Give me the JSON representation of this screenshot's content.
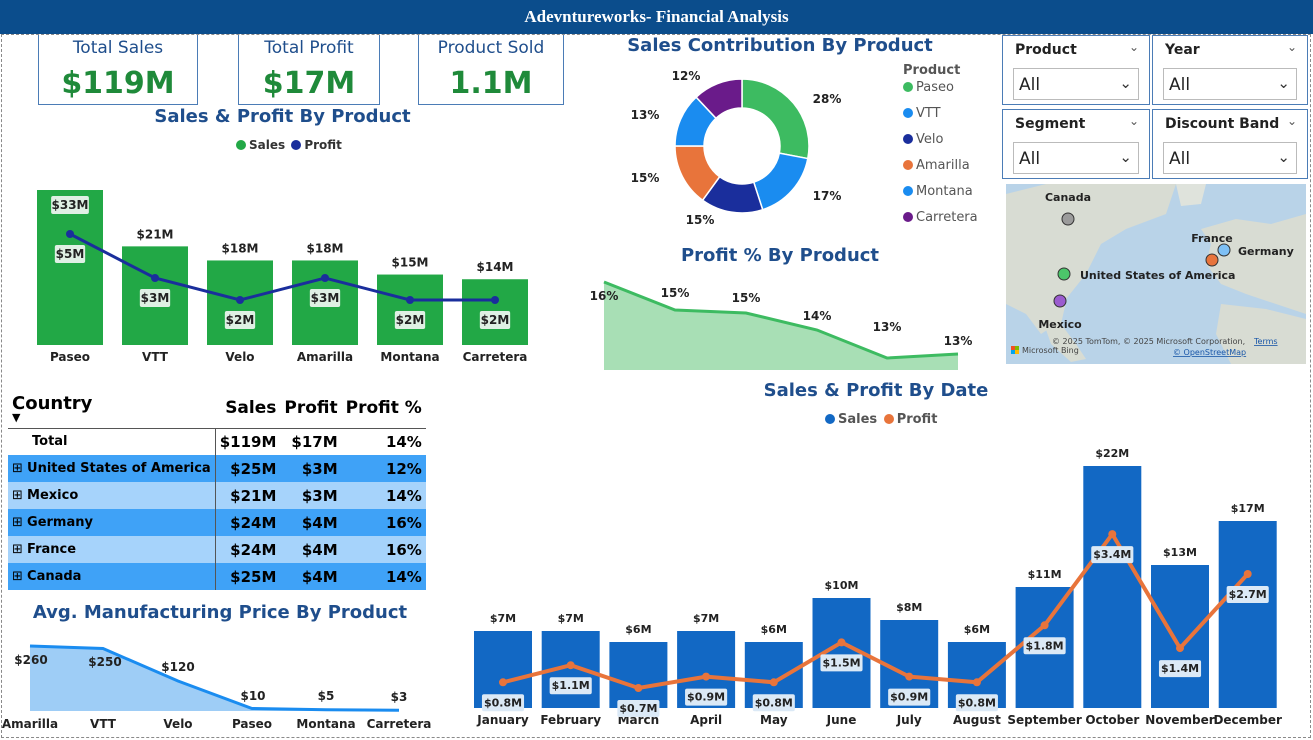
{
  "header": {
    "title": "Adevntureworks- Financial Analysis"
  },
  "kpis": [
    {
      "label": "Total Sales",
      "value": "$119M"
    },
    {
      "label": "Total Profit",
      "value": "$17M"
    },
    {
      "label": "Product Sold",
      "value": "1.1M"
    }
  ],
  "colors": {
    "sales_green": "#22a846",
    "profit_navy": "#1a2e9c",
    "sales_blue": "#1268c4",
    "profit_orange": "#e8743b",
    "area_green": "#a8dfb5",
    "area_blue": "#9ecdf6",
    "title_blue": "#1f4e8c"
  },
  "sales_profit_product": {
    "title": "Sales & Profit By Product",
    "legend": [
      "Sales",
      "Profit"
    ],
    "chart_data": {
      "type": "bar",
      "categories": [
        "Paseo",
        "VTT",
        "Velo",
        "Amarilla",
        "Montana",
        "Carretera"
      ],
      "series": [
        {
          "name": "Sales",
          "values": [
            33,
            21,
            18,
            18,
            15,
            14
          ],
          "labels": [
            "$33M",
            "$21M",
            "$18M",
            "$18M",
            "$15M",
            "$14M"
          ]
        },
        {
          "name": "Profit",
          "values": [
            5,
            3,
            2,
            3,
            2,
            2
          ],
          "labels": [
            "$5M",
            "$3M",
            "$2M",
            "$3M",
            "$2M",
            "$2M"
          ]
        }
      ]
    }
  },
  "sales_contribution": {
    "title": "Sales Contribution By Product",
    "legend_title": "Product",
    "chart_data": {
      "type": "pie",
      "categories": [
        "Paseo",
        "VTT",
        "Velo",
        "Amarilla",
        "Montana",
        "Carretera"
      ],
      "values": [
        28,
        17,
        15,
        15,
        13,
        12
      ],
      "labels": [
        "28%",
        "17%",
        "15%",
        "15%",
        "13%",
        "12%"
      ],
      "colors": [
        "#3dbb61",
        "#1a8cf0",
        "#1a2e9c",
        "#e8743b",
        "#1a8cf0",
        "#6a1b8a"
      ]
    }
  },
  "profit_pct": {
    "title": "Profit % By Product",
    "chart_data": {
      "type": "area",
      "values": [
        16,
        15,
        15,
        14,
        13,
        13
      ],
      "labels": [
        "16%",
        "15%",
        "15%",
        "14%",
        "13%",
        "13%"
      ]
    }
  },
  "slicers": [
    {
      "label": "Product",
      "value": "All"
    },
    {
      "label": "Year",
      "value": "All"
    },
    {
      "label": "Segment",
      "value": "All"
    },
    {
      "label": "Discount Band",
      "value": "All"
    }
  ],
  "map": {
    "countries": [
      "Canada",
      "France",
      "Germany",
      "United States of America",
      "Mexico"
    ],
    "attribution": "© 2025 TomTom, © 2025 Microsoft Corporation,",
    "terms": "Terms",
    "osm": "© OpenStreetMap",
    "bing": "Microsoft Bing"
  },
  "country_table": {
    "headers": [
      "Country",
      "Sales",
      "Profit",
      "Profit %"
    ],
    "total": [
      "Total",
      "$119M",
      "$17M",
      "14%"
    ],
    "rows": [
      [
        "United States of America",
        "$25M",
        "$3M",
        "12%"
      ],
      [
        "Mexico",
        "$21M",
        "$3M",
        "14%"
      ],
      [
        "Germany",
        "$24M",
        "$4M",
        "16%"
      ],
      [
        "France",
        "$24M",
        "$4M",
        "16%"
      ],
      [
        "Canada",
        "$25M",
        "$4M",
        "14%"
      ]
    ],
    "row_colors": [
      "#3fa2f7",
      "#a6d3fb",
      "#3fa2f7",
      "#a6d3fb",
      "#3fa2f7"
    ]
  },
  "avg_price": {
    "title": "Avg. Manufacturing Price By Product",
    "chart_data": {
      "type": "area",
      "categories": [
        "Amarilla",
        "VTT",
        "Velo",
        "Paseo",
        "Montana",
        "Carretera"
      ],
      "values": [
        260,
        250,
        120,
        10,
        5,
        3
      ],
      "labels": [
        "$260",
        "$250",
        "$120",
        "$10",
        "$5",
        "$3"
      ]
    }
  },
  "sales_profit_date": {
    "title": "Sales & Profit By Date",
    "legend": [
      "Sales",
      "Profit"
    ],
    "chart_data": {
      "type": "bar",
      "categories": [
        "January",
        "February",
        "March",
        "April",
        "May",
        "June",
        "July",
        "August",
        "September",
        "October",
        "November",
        "December"
      ],
      "series": [
        {
          "name": "Sales",
          "values": [
            7,
            7,
            6,
            7,
            6,
            10,
            8,
            6,
            11,
            22,
            13,
            17
          ],
          "labels": [
            "$7M",
            "$7M",
            "$6M",
            "$7M",
            "$6M",
            "$10M",
            "$8M",
            "$6M",
            "$11M",
            "$22M",
            "$13M",
            "$17M"
          ]
        },
        {
          "name": "Profit",
          "values": [
            0.8,
            1.1,
            0.7,
            0.9,
            0.8,
            1.5,
            0.9,
            0.8,
            1.8,
            3.4,
            1.4,
            2.7
          ],
          "labels": [
            "$0.8M",
            "$1.1M",
            "$0.7M",
            "$0.9M",
            "$0.8M",
            "$1.5M",
            "$0.9M",
            "$0.8M",
            "$1.8M",
            "$3.4M",
            "$1.4M",
            "$2.7M"
          ]
        }
      ]
    }
  }
}
